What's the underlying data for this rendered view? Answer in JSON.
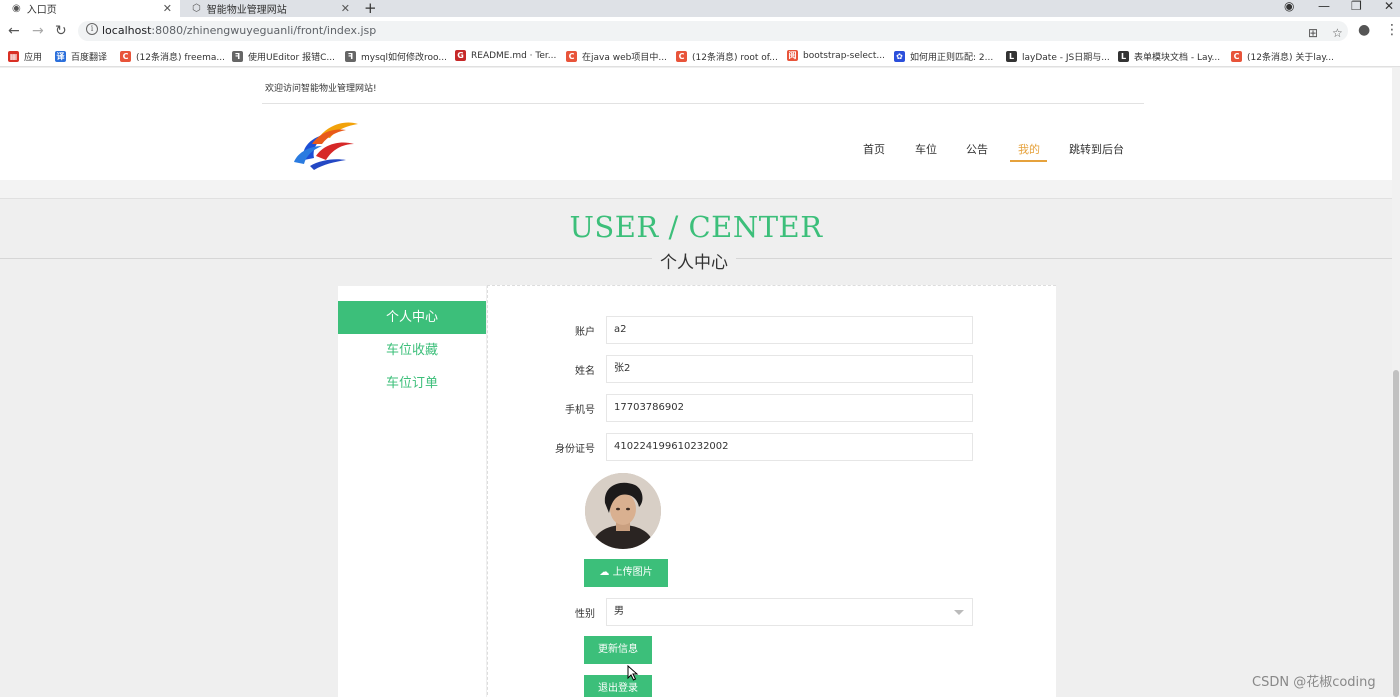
{
  "browser": {
    "tabs": [
      {
        "title": "入口页",
        "active": true
      },
      {
        "title": "智能物业管理网站",
        "active": false
      }
    ],
    "url_host": "localhost",
    "url_path": ":8080/zhinengwuyeguanli/front/index.jsp",
    "bookmarks": [
      {
        "label": "应用",
        "color": "#d93025",
        "glyph": "▦"
      },
      {
        "label": "百度翻译",
        "color": "#2b6fdb",
        "glyph": "译"
      },
      {
        "label": "(12条消息) freema...",
        "color": "#e8543a",
        "glyph": "C"
      },
      {
        "label": "使用UEditor 报错C...",
        "color": "#666666",
        "glyph": "ꟻ"
      },
      {
        "label": "mysql如何修改roo...",
        "color": "#666666",
        "glyph": "ꟻ"
      },
      {
        "label": "README.md · Ter...",
        "color": "#c62828",
        "glyph": "G"
      },
      {
        "label": "在java web项目中...",
        "color": "#e8543a",
        "glyph": "C"
      },
      {
        "label": "(12条消息) root of...",
        "color": "#e8543a",
        "glyph": "C"
      },
      {
        "label": "bootstrap-select...",
        "color": "#e8543a",
        "glyph": "阅"
      },
      {
        "label": "如何用正则匹配: 2...",
        "color": "#2b4fdb",
        "glyph": "✿"
      },
      {
        "label": "layDate - JS日期与...",
        "color": "#333333",
        "glyph": "L"
      },
      {
        "label": "表单模块文档 - Lay...",
        "color": "#333333",
        "glyph": "L"
      },
      {
        "label": "(12条消息) 关于lay...",
        "color": "#e8543a",
        "glyph": "C"
      }
    ]
  },
  "site": {
    "welcome": "欢迎访问智能物业管理网站!",
    "nav": [
      "首页",
      "车位",
      "公告",
      "我的",
      "跳转到后台"
    ],
    "active_nav": "我的"
  },
  "section": {
    "title_en": "USER / CENTER",
    "title_cn": "个人中心"
  },
  "sidebar": {
    "items": [
      "个人中心",
      "车位收藏",
      "车位订单"
    ],
    "active": "个人中心"
  },
  "form": {
    "account_label": "账户",
    "account_value": "a2",
    "name_label": "姓名",
    "name_value": "张2",
    "phone_label": "手机号",
    "phone_value": "17703786902",
    "idcard_label": "身份证号",
    "idcard_value": "410224199610232002",
    "upload_label": "上传图片",
    "gender_label": "性别",
    "gender_value": "男",
    "update_label": "更新信息",
    "logout_label": "退出登录"
  },
  "watermark": "CSDN @花椒coding",
  "colors": {
    "accent": "#3cbf7a",
    "nav_active": "#e6a23c"
  }
}
